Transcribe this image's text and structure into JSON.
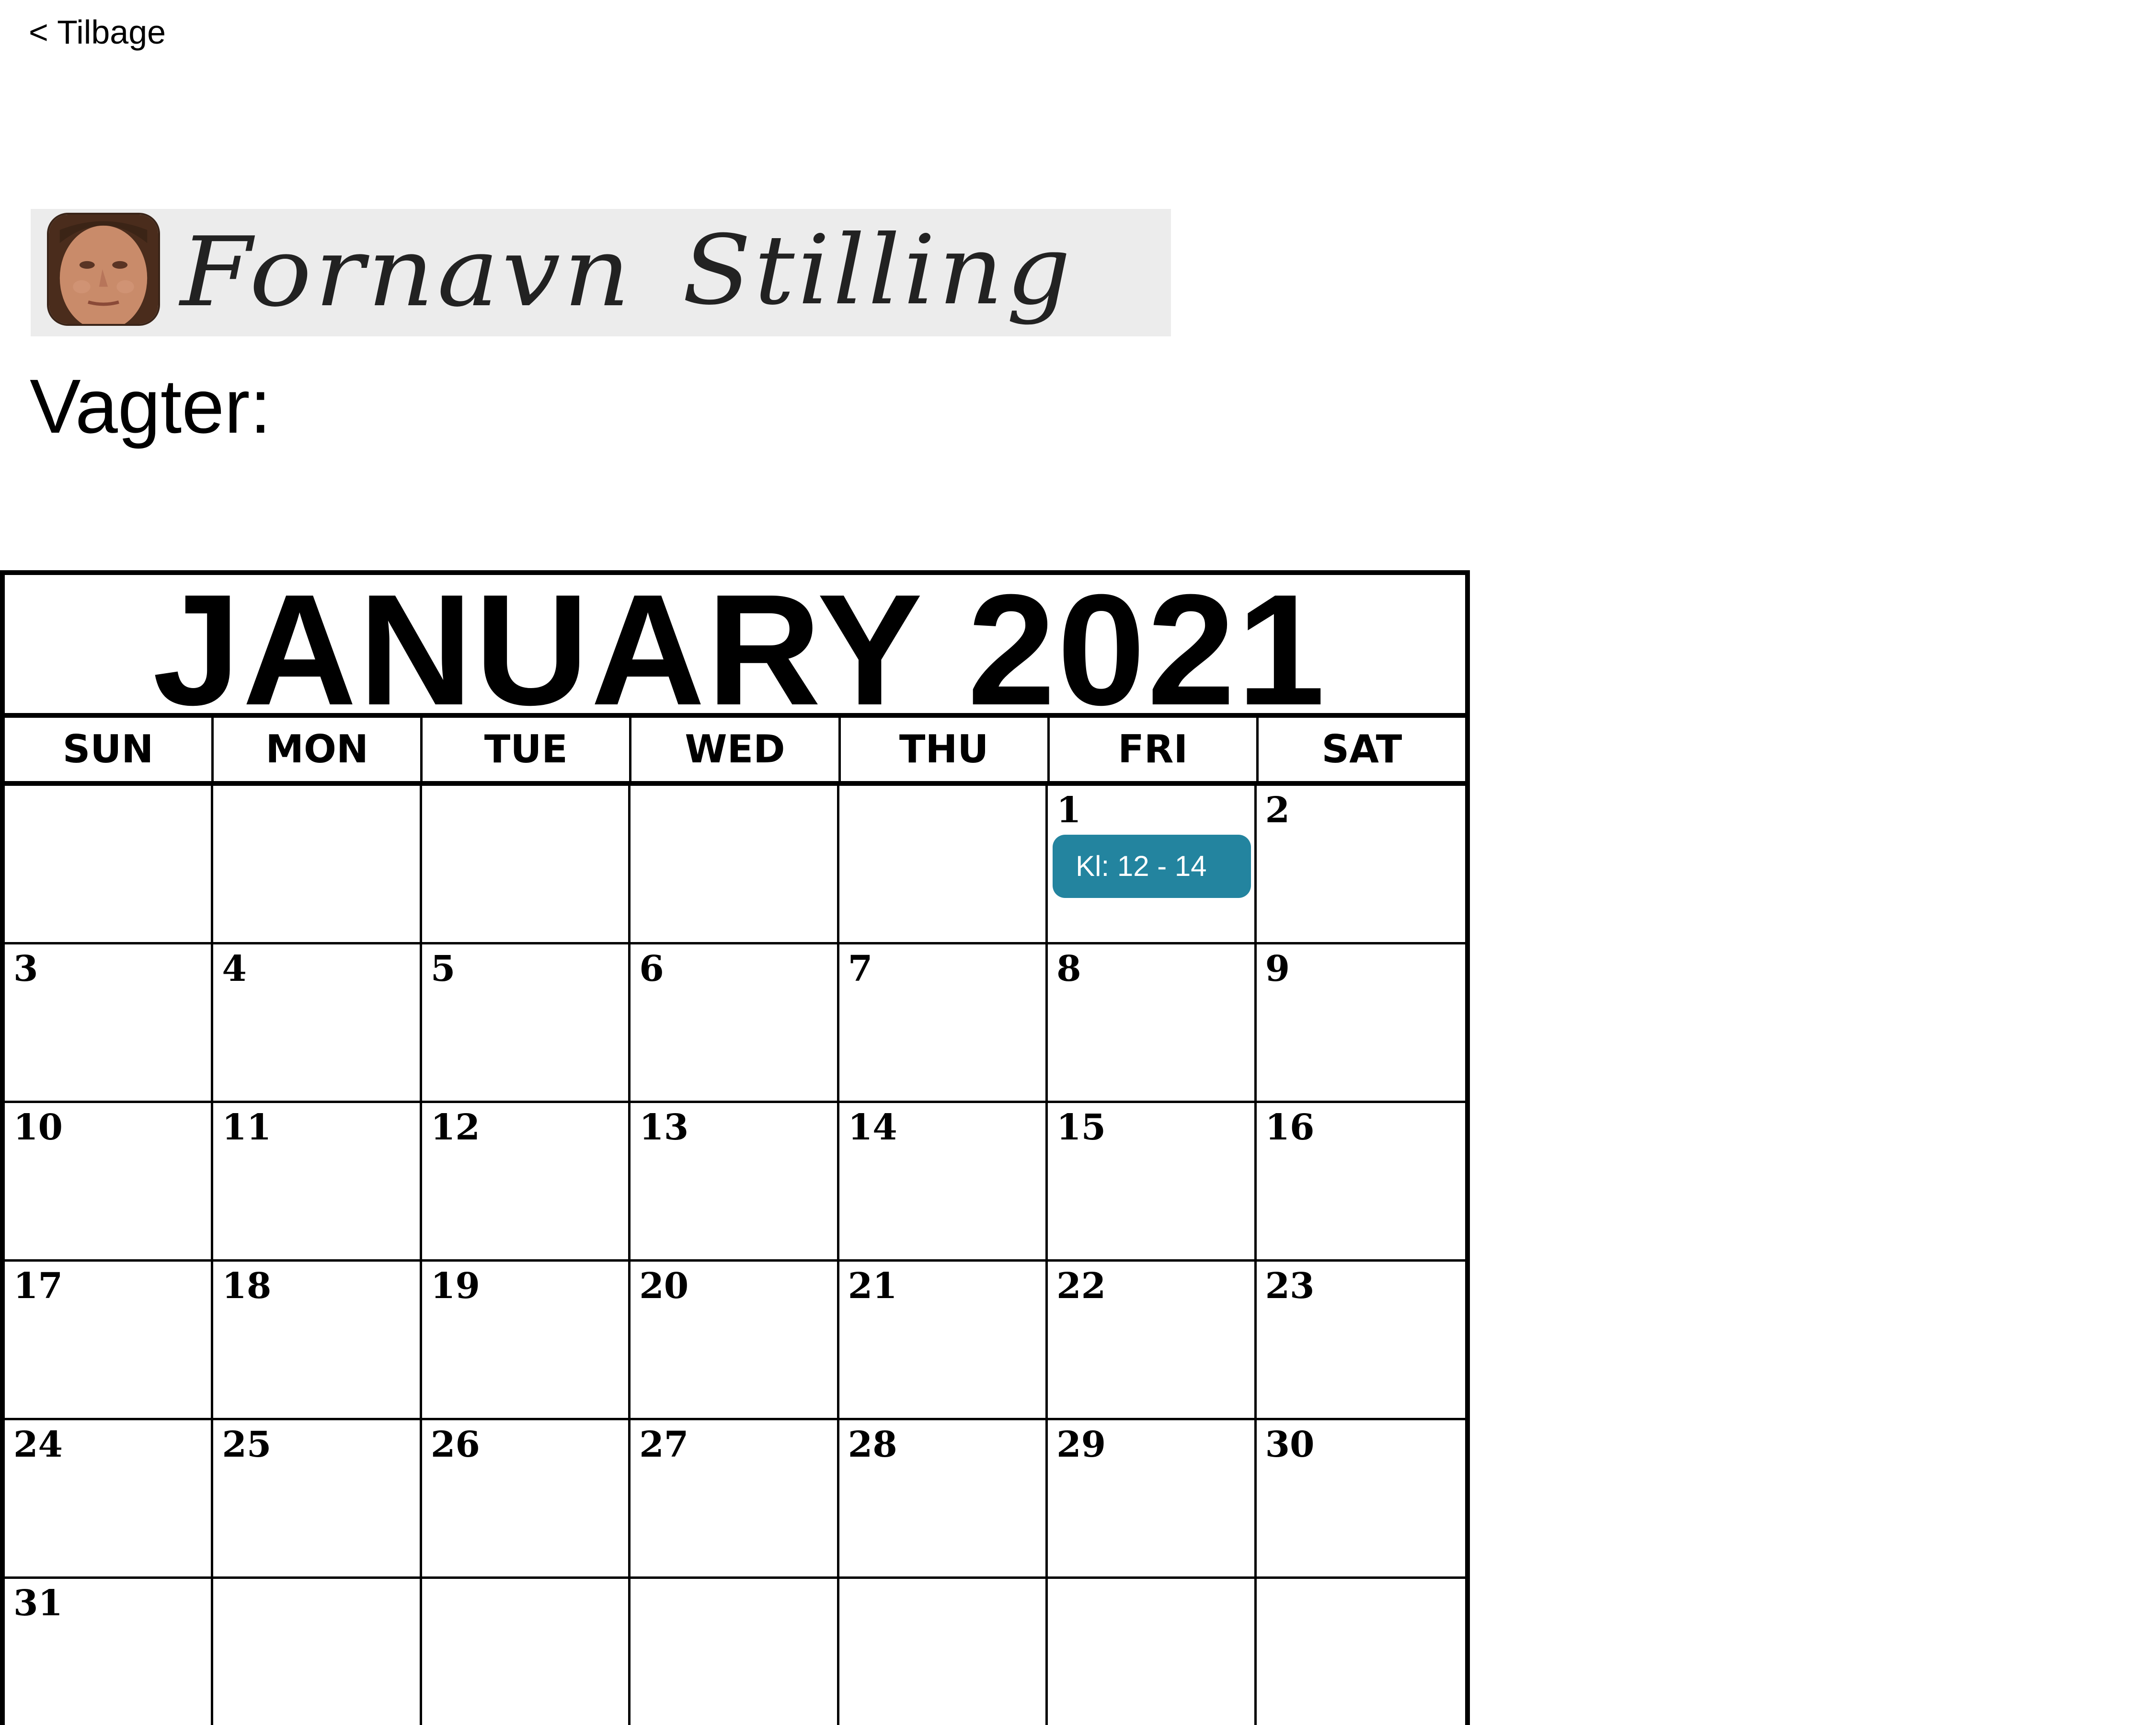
{
  "nav": {
    "back_label": "< Tilbage"
  },
  "profile": {
    "first_name": "Fornavn",
    "position": "Stilling"
  },
  "shifts_heading": "Vagter:",
  "calendar": {
    "title": "JANUARY 2021",
    "weekdays": [
      "SUN",
      "MON",
      "TUE",
      "WED",
      "THU",
      "FRI",
      "SAT"
    ],
    "leading_blank_days": 5,
    "days_in_month": 31,
    "shift_day": 1,
    "shift_label": "Kl: 12 - 14",
    "shift_color": "#23849f"
  }
}
